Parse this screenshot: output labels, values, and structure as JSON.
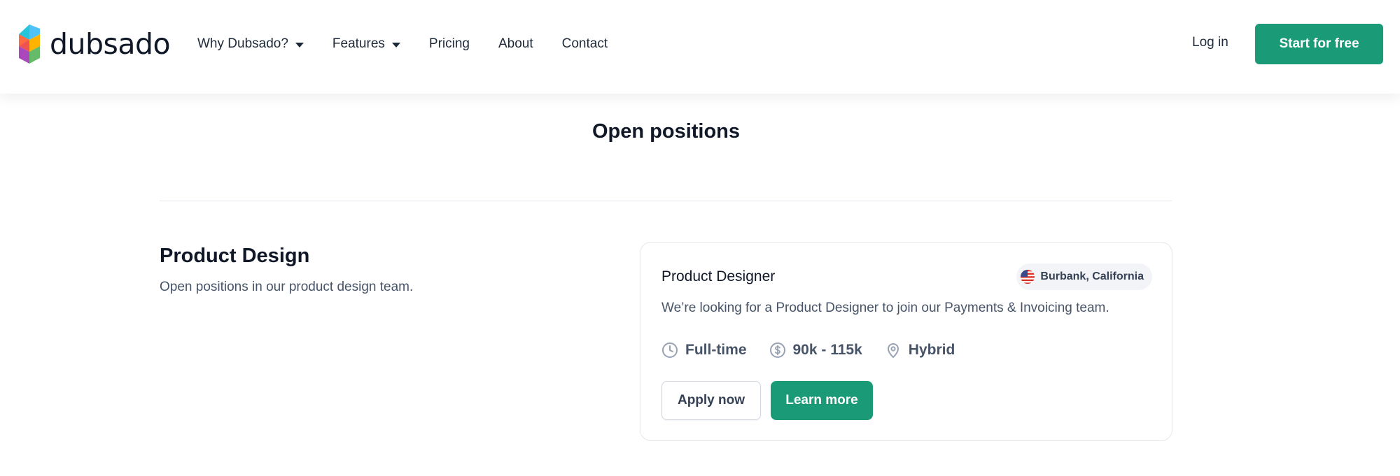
{
  "header": {
    "logo_text": "dubsado",
    "nav": [
      {
        "label": "Why Dubsado?",
        "has_dropdown": true
      },
      {
        "label": "Features",
        "has_dropdown": true
      },
      {
        "label": "Pricing",
        "has_dropdown": false
      },
      {
        "label": "About",
        "has_dropdown": false
      },
      {
        "label": "Contact",
        "has_dropdown": false
      }
    ],
    "login_label": "Log in",
    "cta_label": "Start for free"
  },
  "main": {
    "title": "Open positions",
    "section": {
      "title": "Product Design",
      "subtitle": "Open positions in our product design team."
    },
    "job": {
      "title": "Product Designer",
      "location": "Burbank, California",
      "description": "We’re looking for a Product Designer to join our Payments & Invoicing team.",
      "type": "Full-time",
      "salary": "90k - 115k",
      "workplace": "Hybrid",
      "apply_label": "Apply now",
      "learn_label": "Learn more"
    }
  },
  "colors": {
    "accent": "#1b9a78",
    "text_dark": "#101828",
    "text_muted": "#475467",
    "border": "#e4e7ec"
  },
  "icons": {
    "job_type": "clock-icon",
    "salary": "dollar-circle-icon",
    "workplace": "map-pin-icon",
    "location_flag": "us-flag-icon"
  }
}
